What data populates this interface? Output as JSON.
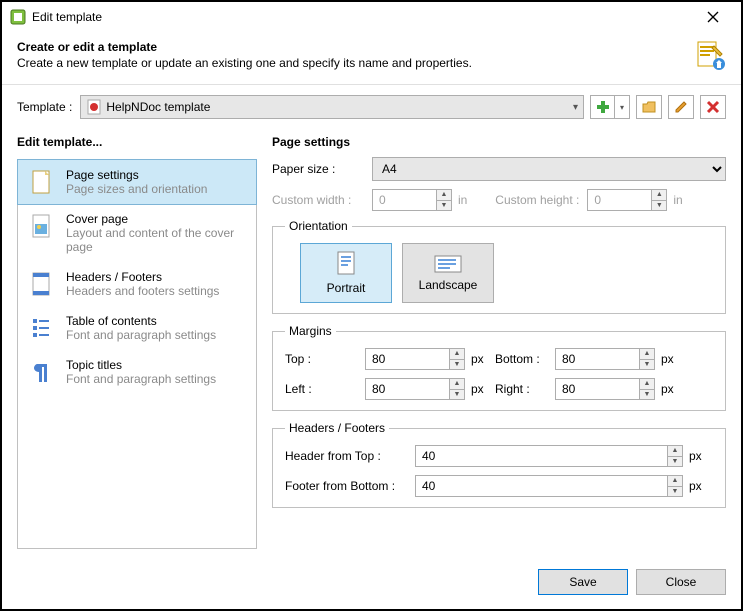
{
  "window": {
    "title": "Edit template"
  },
  "header": {
    "title": "Create or edit a template",
    "subtitle": "Create a new template or update an existing one and specify its name and properties."
  },
  "template": {
    "label": "Template :",
    "selected": "HelpNDoc template"
  },
  "sidebar": {
    "title": "Edit template...",
    "items": [
      {
        "label": "Page settings",
        "sub": "Page sizes and orientation"
      },
      {
        "label": "Cover page",
        "sub": "Layout and content of the cover page"
      },
      {
        "label": "Headers / Footers",
        "sub": "Headers and footers settings"
      },
      {
        "label": "Table of contents",
        "sub": "Font and paragraph settings"
      },
      {
        "label": "Topic titles",
        "sub": "Font and paragraph settings"
      }
    ]
  },
  "page": {
    "title": "Page settings",
    "paperSizeLabel": "Paper size :",
    "paperSize": "A4",
    "customWidthLabel": "Custom width :",
    "customWidth": "0",
    "customHeightLabel": "Custom height :",
    "customHeight": "0",
    "unitIn": "in",
    "orientation": {
      "legend": "Orientation",
      "portrait": "Portrait",
      "landscape": "Landscape"
    },
    "margins": {
      "legend": "Margins",
      "topLabel": "Top :",
      "top": "80",
      "bottomLabel": "Bottom :",
      "bottom": "80",
      "leftLabel": "Left :",
      "left": "80",
      "rightLabel": "Right :",
      "right": "80",
      "unit": "px"
    },
    "hf": {
      "legend": "Headers / Footers",
      "headerLabel": "Header from Top :",
      "header": "40",
      "footerLabel": "Footer from Bottom :",
      "footer": "40",
      "unit": "px"
    }
  },
  "buttons": {
    "save": "Save",
    "close": "Close"
  }
}
